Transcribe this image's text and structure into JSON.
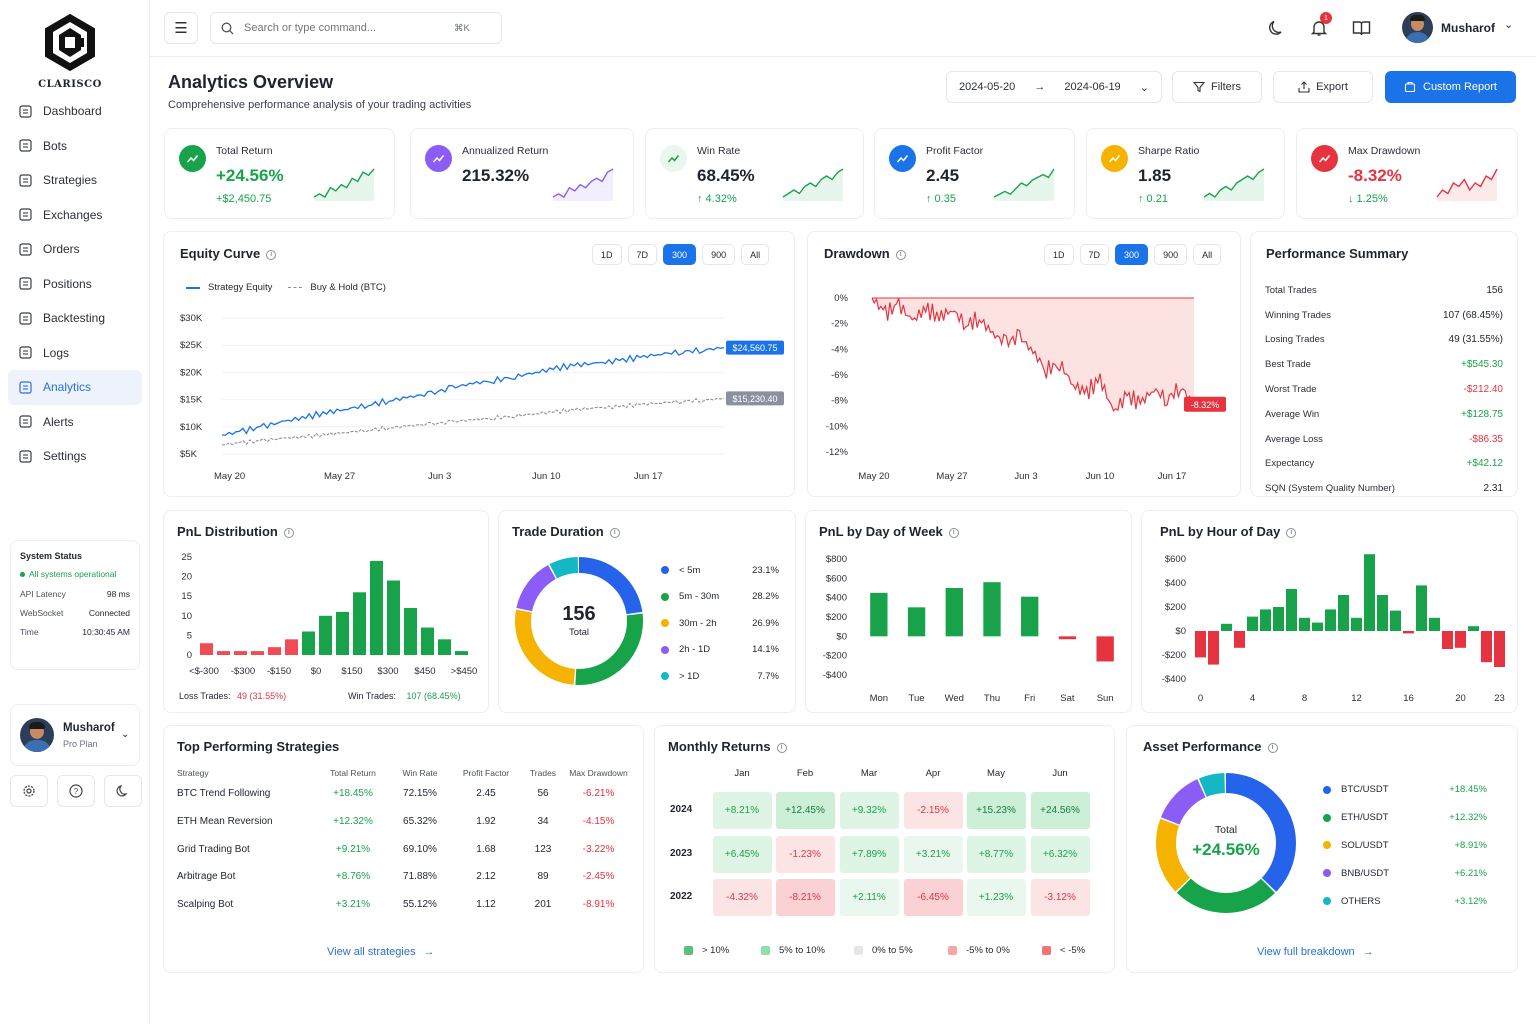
{
  "app": {
    "brand": "CLARISCO"
  },
  "sidebar": {
    "items": [
      {
        "label": "Dashboard",
        "icon": "dashboard-icon"
      },
      {
        "label": "Bots",
        "icon": "bot-icon"
      },
      {
        "label": "Strategies",
        "icon": "strategy-icon"
      },
      {
        "label": "Exchanges",
        "icon": "exchange-icon"
      },
      {
        "label": "Orders",
        "icon": "orders-icon"
      },
      {
        "label": "Positions",
        "icon": "positions-icon"
      },
      {
        "label": "Backtesting",
        "icon": "backtest-icon"
      },
      {
        "label": "Logs",
        "icon": "logs-icon"
      },
      {
        "label": "Analytics",
        "icon": "analytics-icon",
        "active": true
      },
      {
        "label": "Alerts",
        "icon": "bell-icon"
      },
      {
        "label": "Settings",
        "icon": "gear-icon"
      }
    ],
    "status": {
      "title": "System Status",
      "operational": "All systems operational",
      "rows": [
        {
          "k": "API Latency",
          "v": "98 ms"
        },
        {
          "k": "WebSocket",
          "v": "Connected"
        },
        {
          "k": "Time",
          "v": "10:30:45 AM"
        }
      ]
    },
    "user": {
      "name": "Musharof",
      "plan": "Pro Plan"
    }
  },
  "header": {
    "search_placeholder": "Search or type command...",
    "shortcut": "⌘K",
    "notifications": "1",
    "user": "Musharof"
  },
  "page": {
    "title": "Analytics Overview",
    "subtitle": "Comprehensive performance analysis of your trading activities",
    "date_from": "2024-05-20",
    "date_to": "2024-06-19",
    "filters": "Filters",
    "export": "Export",
    "custom_report": "Custom Report"
  },
  "kpis": [
    {
      "label": "Total Return",
      "value": "+24.56%",
      "sub": "+$2,450.75",
      "color": "#18a34a",
      "icon_bg": "#18a34a",
      "icon": "trend-up-icon",
      "spark": [
        3,
        4,
        3,
        6,
        5,
        7,
        6,
        9,
        8,
        11,
        10,
        12
      ]
    },
    {
      "label": "Annualized Return",
      "value": "215.32%",
      "sub": "",
      "color": "#1f2430",
      "icon_bg": "#8b5cf6",
      "icon": "chart-icon",
      "spark": [
        2,
        3,
        2,
        5,
        4,
        6,
        5,
        7,
        8,
        7,
        10,
        11
      ]
    },
    {
      "label": "Win Rate",
      "value": "68.45%",
      "sub": "↑ 4.32%",
      "color": "#1f2430",
      "icon_bg": "#e9f7ee",
      "icon": "trophy-icon",
      "spark": [
        3,
        4,
        5,
        4,
        6,
        7,
        6,
        8,
        9,
        8,
        10,
        11
      ]
    },
    {
      "label": "Profit Factor",
      "value": "2.45",
      "sub": "↑ 0.35",
      "color": "#1f2430",
      "icon_bg": "#1a73e8",
      "icon": "scale-icon",
      "spark": [
        2,
        3,
        4,
        3,
        5,
        7,
        6,
        8,
        9,
        10,
        9,
        12
      ]
    },
    {
      "label": "Sharpe Ratio",
      "value": "1.85",
      "sub": "↑ 0.21",
      "color": "#1f2430",
      "icon_bg": "#f5b300",
      "icon": "target-icon",
      "spark": [
        3,
        4,
        3,
        5,
        6,
        5,
        7,
        8,
        9,
        8,
        10,
        11
      ]
    },
    {
      "label": "Max Drawdown",
      "value": "-8.32%",
      "sub": "↓ 1.25%",
      "color": "#e5343f",
      "icon_bg": "#e5343f",
      "icon": "drawdown-icon",
      "spark": [
        4,
        6,
        5,
        8,
        7,
        9,
        6,
        8,
        7,
        10,
        9,
        12
      ]
    }
  ],
  "equity": {
    "title": "Equity Curve",
    "ranges": [
      "1D",
      "7D",
      "300",
      "900",
      "All"
    ],
    "active": "300",
    "legend": [
      "Strategy Equity",
      "Buy & Hold (BTC)"
    ],
    "end_strategy": "$24,560.75",
    "end_bh": "$15,230.40"
  },
  "drawdown": {
    "title": "Drawdown",
    "ranges": [
      "1D",
      "7D",
      "300",
      "900",
      "All"
    ],
    "active": "300",
    "end_label": "-8.32%"
  },
  "summary": {
    "title": "Performance Summary",
    "rows": [
      {
        "k": "Total Trades",
        "v": "156",
        "c": ""
      },
      {
        "k": "Winning Trades",
        "v": "107 (68.45%)",
        "c": ""
      },
      {
        "k": "Losing Trades",
        "v": "49 (31.55%)",
        "c": ""
      },
      {
        "k": "Best Trade",
        "v": "+$545.30",
        "c": "green"
      },
      {
        "k": "Worst Trade",
        "v": "-$212.40",
        "c": "red"
      },
      {
        "k": "Average Win",
        "v": "+$128.75",
        "c": "green"
      },
      {
        "k": "Average Loss",
        "v": "-$86.35",
        "c": "red"
      },
      {
        "k": "Expectancy",
        "v": "+$42.12",
        "c": "green"
      },
      {
        "k": "SQN (System Quality Number)",
        "v": "2.31",
        "c": ""
      }
    ]
  },
  "pnl_dist": {
    "title": "PnL Distribution",
    "loss_label": "Loss Trades:",
    "loss_value": "49 (31.55%)",
    "win_label": "Win Trades:",
    "win_value": "107 (68.45%)"
  },
  "trade_duration": {
    "title": "Trade Duration",
    "total": "156",
    "total_label": "Total",
    "items": [
      {
        "label": "< 5m",
        "value": "23.1%",
        "color": "#2563eb"
      },
      {
        "label": "5m - 30m",
        "value": "28.2%",
        "color": "#16a34a"
      },
      {
        "label": "30m - 2h",
        "value": "26.9%",
        "color": "#f5b300"
      },
      {
        "label": "2h - 1D",
        "value": "14.1%",
        "color": "#8b5cf6"
      },
      {
        "label": "> 1D",
        "value": "7.7%",
        "color": "#14b8c4"
      }
    ]
  },
  "pnl_dow": {
    "title": "PnL by Day of Week"
  },
  "pnl_hour": {
    "title": "PnL by Hour of Day"
  },
  "strategies": {
    "title": "Top Performing Strategies",
    "headers": [
      "Strategy",
      "Total Return",
      "Win Rate",
      "Profit Factor",
      "Trades",
      "Max Drawdown"
    ],
    "rows": [
      [
        "BTC Trend Following",
        "+18.45%",
        "72.15%",
        "2.45",
        "56",
        "-6.21%"
      ],
      [
        "ETH Mean Reversion",
        "+12.32%",
        "65.32%",
        "1.92",
        "34",
        "-4.15%"
      ],
      [
        "Grid Trading Bot",
        "+9.21%",
        "69.10%",
        "1.68",
        "123",
        "-3.22%"
      ],
      [
        "Arbitrage Bot",
        "+8.76%",
        "71.88%",
        "2.12",
        "89",
        "-2.45%"
      ],
      [
        "Scalping Bot",
        "+3.21%",
        "55.12%",
        "1.12",
        "201",
        "-8.91%"
      ]
    ],
    "view_all": "View all strategies"
  },
  "monthly": {
    "title": "Monthly Returns",
    "months": [
      "Jan",
      "Feb",
      "Mar",
      "Apr",
      "May",
      "Jun"
    ],
    "rows": [
      {
        "year": "2024",
        "vals": [
          "+8.21%",
          "+12.45%",
          "+9.32%",
          "-2.15%",
          "+15.23%",
          "+24.56%"
        ]
      },
      {
        "year": "2023",
        "vals": [
          "+6.45%",
          "-1.23%",
          "+7.89%",
          "+3.21%",
          "+8.77%",
          "+6.32%"
        ]
      },
      {
        "year": "2022",
        "vals": [
          "-4.32%",
          "-8.21%",
          "+2.11%",
          "-6.45%",
          "+1.23%",
          "-3.12%"
        ]
      }
    ],
    "legend": [
      "> 10%",
      "5% to 10%",
      "0% to 5%",
      "-5% to 0%",
      "< -5%"
    ]
  },
  "asset": {
    "title": "Asset Performance",
    "total_label": "Total",
    "total_value": "+24.56%",
    "items": [
      {
        "label": "BTC/USDT",
        "value": "+18.45%",
        "color": "#2563eb"
      },
      {
        "label": "ETH/USDT",
        "value": "+12.32%",
        "color": "#16a34a"
      },
      {
        "label": "SOL/USDT",
        "value": "+8.91%",
        "color": "#f5b300"
      },
      {
        "label": "BNB/USDT",
        "value": "+6.21%",
        "color": "#8b5cf6"
      },
      {
        "label": "OTHERS",
        "value": "+3.12%",
        "color": "#14b8c4"
      }
    ],
    "view_all": "View full breakdown"
  },
  "chart_data": [
    {
      "type": "line",
      "title": "Equity Curve",
      "x_ticks": [
        "May 20",
        "May 27",
        "Jun 3",
        "Jun 10",
        "Jun 17"
      ],
      "y_ticks": [
        "$30K",
        "$25K",
        "$20K",
        "$15K",
        "$10K",
        "$5K"
      ],
      "ylim": [
        5000,
        30000
      ],
      "series": [
        {
          "name": "Strategy Equity",
          "values": [
            8500,
            9200,
            10100,
            11000,
            11800,
            12600,
            13300,
            14000,
            14800,
            15500,
            16100,
            17200,
            18000,
            18500,
            19200,
            20000,
            20800,
            21400,
            21700,
            22200,
            22800,
            23400,
            23800,
            24100,
            24560
          ]
        },
        {
          "name": "Buy & Hold (BTC)",
          "values": [
            6700,
            7100,
            7500,
            7900,
            8200,
            8600,
            9000,
            9400,
            9800,
            10200,
            10500,
            10900,
            11300,
            11600,
            12000,
            12400,
            12800,
            13200,
            13500,
            13700,
            14100,
            14400,
            14700,
            14900,
            15230
          ]
        }
      ]
    },
    {
      "type": "area",
      "title": "Drawdown",
      "x_ticks": [
        "May 20",
        "May 27",
        "Jun 3",
        "Jun 10",
        "Jun 17"
      ],
      "y_ticks": [
        "0%",
        "-2%",
        "-4%",
        "-6%",
        "-8%",
        "-10%",
        "-12%"
      ],
      "ylim": [
        -12,
        0
      ],
      "values": [
        0,
        -1.2,
        -0.5,
        -1.8,
        -0.8,
        -1.5,
        -0.9,
        -2.1,
        -1.6,
        -2.8,
        -3.5,
        -3.0,
        -4.2,
        -5.6,
        -5.1,
        -6.8,
        -7.4,
        -6.3,
        -8.9,
        -7.6,
        -8.2,
        -7.1,
        -7.9,
        -6.9,
        -8.32
      ]
    },
    {
      "type": "bar",
      "title": "PnL Distribution",
      "categories": [
        "<$-300",
        "-$300",
        "-$150",
        "$0",
        "$150",
        "$300",
        "$450",
        ">$450"
      ],
      "y_ticks": [
        "25",
        "20",
        "15",
        "10",
        "5",
        "0"
      ],
      "ylim": [
        0,
        25
      ],
      "values": [
        3,
        1,
        1,
        1,
        2,
        4,
        6,
        10,
        11,
        16,
        24,
        19,
        12,
        7,
        4,
        1
      ],
      "colors": [
        "red",
        "red",
        "red",
        "red",
        "red",
        "red",
        "green",
        "green",
        "green",
        "green",
        "green",
        "green",
        "green",
        "green",
        "green",
        "green"
      ]
    },
    {
      "type": "pie",
      "title": "Trade Duration",
      "values": [
        23.1,
        28.2,
        26.9,
        14.1,
        7.7
      ]
    },
    {
      "type": "bar",
      "title": "PnL by Day of Week",
      "categories": [
        "Mon",
        "Tue",
        "Wed",
        "Thu",
        "Fri",
        "Sat",
        "Sun"
      ],
      "y_ticks": [
        "$800",
        "$600",
        "$400",
        "$200",
        "$0",
        "-$200",
        "-$400"
      ],
      "ylim": [
        -400,
        800
      ],
      "values": [
        450,
        300,
        500,
        560,
        410,
        -30,
        -260
      ]
    },
    {
      "type": "bar",
      "title": "PnL by Hour of Day",
      "categories": [
        "0",
        "1",
        "2",
        "3",
        "4",
        "5",
        "6",
        "7",
        "8",
        "9",
        "10",
        "11",
        "12",
        "13",
        "14",
        "15",
        "16",
        "17",
        "18",
        "19",
        "20",
        "21",
        "22",
        "23"
      ],
      "x_ticks": [
        "0",
        "4",
        "8",
        "12",
        "16",
        "20",
        "23"
      ],
      "y_ticks": [
        "$600",
        "$400",
        "$200",
        "$0",
        "-$200",
        "-$400"
      ],
      "ylim": [
        -400,
        600
      ],
      "values": [
        -220,
        -280,
        60,
        -140,
        120,
        180,
        200,
        350,
        110,
        70,
        180,
        300,
        110,
        640,
        300,
        170,
        -20,
        380,
        110,
        -150,
        -140,
        40,
        -260,
        -300
      ]
    },
    {
      "type": "pie",
      "title": "Asset Performance",
      "values": [
        18.45,
        12.32,
        8.91,
        6.21,
        3.12
      ]
    }
  ]
}
